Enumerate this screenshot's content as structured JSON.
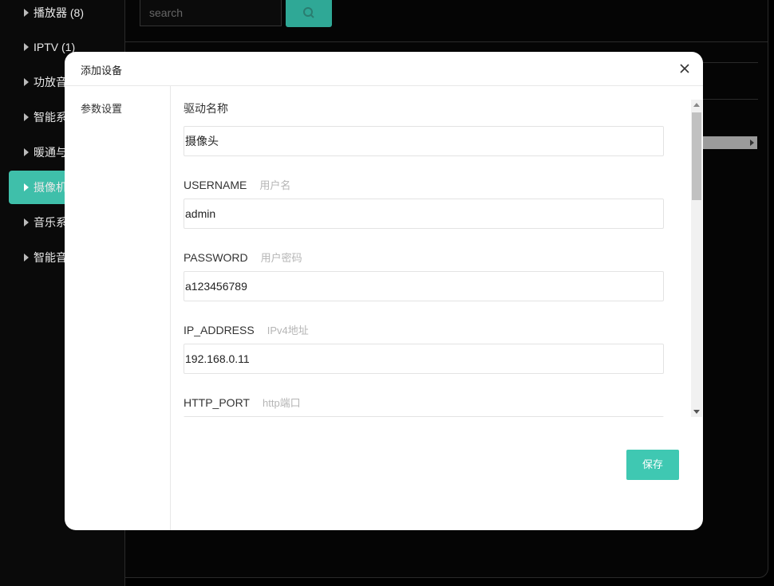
{
  "background": {
    "sidebar": {
      "categories": [
        {
          "label": "播放器 (8)"
        },
        {
          "label": "IPTV (1)"
        },
        {
          "label": "功放音"
        },
        {
          "label": "智能系"
        },
        {
          "label": "暖通与"
        },
        {
          "label": "摄像机"
        },
        {
          "label": "音乐系"
        },
        {
          "label": "智能音"
        }
      ],
      "active_index": 5
    },
    "search": {
      "placeholder": "search",
      "icon": "search-icon"
    }
  },
  "modal": {
    "title": "添加设备",
    "close_icon": "close-icon",
    "side_tab": "参数设置",
    "fields": [
      {
        "label": "驱动名称",
        "hint": "",
        "value": "摄像头"
      },
      {
        "label": "USERNAME",
        "hint": "用户名",
        "value": "admin"
      },
      {
        "label": "PASSWORD",
        "hint": "用户密码",
        "value": "a123456789"
      },
      {
        "label": "IP_ADDRESS",
        "hint": "IPv4地址",
        "value": "192.168.0.11"
      },
      {
        "label": "HTTP_PORT",
        "hint": "http端口",
        "value": ""
      }
    ],
    "save_label": "保存"
  },
  "colors": {
    "accent": "#3fc8b2",
    "active_item": "#3fbfaa"
  }
}
